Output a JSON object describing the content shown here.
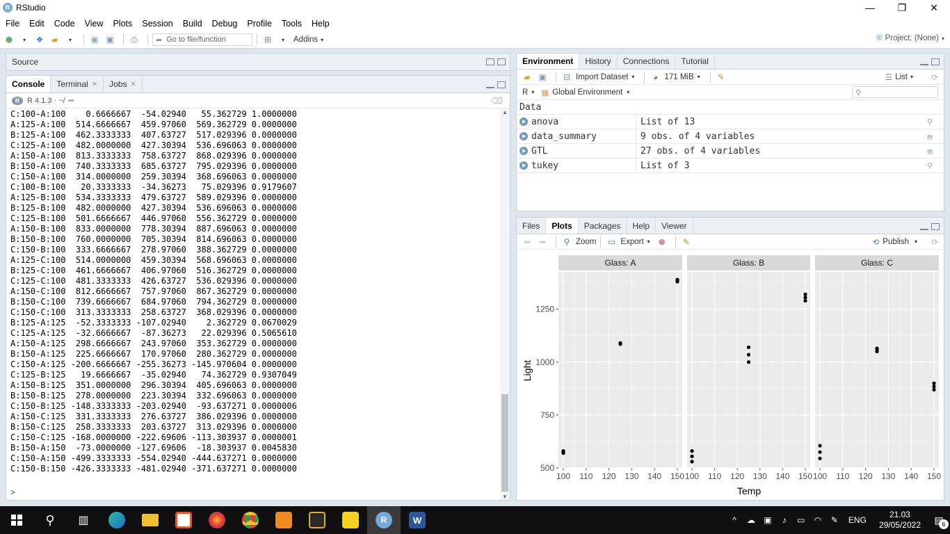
{
  "window": {
    "title": "RStudio",
    "min": "—",
    "restore": "❐",
    "close": "✕"
  },
  "menu": [
    "File",
    "Edit",
    "Code",
    "View",
    "Plots",
    "Session",
    "Build",
    "Debug",
    "Profile",
    "Tools",
    "Help"
  ],
  "toolbar": {
    "goto_placeholder": "Go to file/function",
    "addins": "Addins",
    "project": "Project: (None)"
  },
  "source_panel": {
    "title": "Source"
  },
  "console_panel": {
    "tabs": [
      "Console",
      "Terminal",
      "Jobs"
    ],
    "r_version": "R 4.1.3 · ~/",
    "lines": [
      "C:100-A:100    0.6666667  -54.02940   55.362729 1.0000000",
      "A:125-A:100  514.6666667  459.97060  569.362729 0.0000000",
      "B:125-A:100  462.3333333  407.63727  517.029396 0.0000000",
      "C:125-A:100  482.0000000  427.30394  536.696063 0.0000000",
      "A:150-A:100  813.3333333  758.63727  868.029396 0.0000000",
      "B:150-A:100  740.3333333  685.63727  795.029396 0.0000000",
      "C:150-A:100  314.0000000  259.30394  368.696063 0.0000000",
      "C:100-B:100   20.3333333  -34.36273   75.029396 0.9179607",
      "A:125-B:100  534.3333333  479.63727  589.029396 0.0000000",
      "B:125-B:100  482.0000000  427.30394  536.696063 0.0000000",
      "C:125-B:100  501.6666667  446.97060  556.362729 0.0000000",
      "A:150-B:100  833.0000000  778.30394  887.696063 0.0000000",
      "B:150-B:100  760.0000000  705.30394  814.696063 0.0000000",
      "C:150-B:100  333.6666667  278.97060  388.362729 0.0000000",
      "A:125-C:100  514.0000000  459.30394  568.696063 0.0000000",
      "B:125-C:100  461.6666667  406.97060  516.362729 0.0000000",
      "C:125-C:100  481.3333333  426.63727  536.029396 0.0000000",
      "A:150-C:100  812.6666667  757.97060  867.362729 0.0000000",
      "B:150-C:100  739.6666667  684.97060  794.362729 0.0000000",
      "C:150-C:100  313.3333333  258.63727  368.029396 0.0000000",
      "B:125-A:125  -52.3333333 -107.02940    2.362729 0.0670029",
      "C:125-A:125  -32.6666667  -87.36273   22.029396 0.5065610",
      "A:150-A:125  298.6666667  243.97060  353.362729 0.0000000",
      "B:150-A:125  225.6666667  170.97060  280.362729 0.0000000",
      "C:150-A:125 -200.6666667 -255.36273 -145.970604 0.0000000",
      "C:125-B:125   19.6666667  -35.02940   74.362729 0.9307049",
      "A:150-B:125  351.0000000  296.30394  405.696063 0.0000000",
      "B:150-B:125  278.0000000  223.30394  332.696063 0.0000000",
      "C:150-B:125 -148.3333333 -203.02940  -93.637271 0.0000006",
      "A:150-C:125  331.3333333  276.63727  386.029396 0.0000000",
      "B:150-C:125  258.3333333  203.63727  313.029396 0.0000000",
      "C:150-C:125 -168.0000000 -222.69606 -113.303937 0.0000001",
      "B:150-A:150  -73.0000000 -127.69606  -18.303937 0.0045830",
      "C:150-A:150 -499.3333333 -554.02940 -444.637271 0.0000000",
      "C:150-B:150 -426.3333333 -481.02940 -371.637271 0.0000000"
    ],
    "prompt": ">"
  },
  "env_panel": {
    "tabs": [
      "Environment",
      "History",
      "Connections",
      "Tutorial"
    ],
    "import_label": "Import Dataset",
    "memory": "171 MiB",
    "list_label": "List",
    "lang": "R",
    "scope": "Global Environment",
    "section": "Data",
    "rows": [
      {
        "name": "anova",
        "value": "List of  13"
      },
      {
        "name": "data_summary",
        "value": "9 obs. of 4 variables"
      },
      {
        "name": "GTL",
        "value": "27 obs. of 4 variables"
      },
      {
        "name": "tukey",
        "value": "List of  3"
      }
    ]
  },
  "files_panel": {
    "tabs": [
      "Files",
      "Plots",
      "Packages",
      "Help",
      "Viewer"
    ],
    "zoom": "Zoom",
    "export": "Export",
    "publish": "Publish"
  },
  "chart_data": {
    "type": "scatter",
    "xlabel": "Temp",
    "ylabel": "Light",
    "ylim": [
      500,
      1400
    ],
    "xlim": [
      100,
      150
    ],
    "x_ticks": [
      100,
      110,
      120,
      130,
      140,
      150
    ],
    "y_ticks": [
      500,
      750,
      1000,
      1250
    ],
    "facets": [
      {
        "name": "Glass: A",
        "x": [
          100,
          100,
          100,
          125,
          125,
          125,
          150,
          150,
          150
        ],
        "y": [
          570,
          575,
          580,
          1085,
          1087,
          1090,
          1380,
          1385,
          1390
        ]
      },
      {
        "name": "Glass: B",
        "x": [
          100,
          100,
          100,
          125,
          125,
          125,
          150,
          150,
          150
        ],
        "y": [
          530,
          555,
          580,
          1000,
          1035,
          1070,
          1290,
          1305,
          1320
        ]
      },
      {
        "name": "Glass: C",
        "x": [
          100,
          100,
          100,
          125,
          125,
          125,
          150,
          150,
          150
        ],
        "y": [
          545,
          575,
          605,
          1050,
          1060,
          1065,
          870,
          885,
          900
        ]
      }
    ]
  },
  "taskbar": {
    "lang": "ENG",
    "time": "21.03",
    "date": "29/05/2022",
    "notif": "6"
  }
}
